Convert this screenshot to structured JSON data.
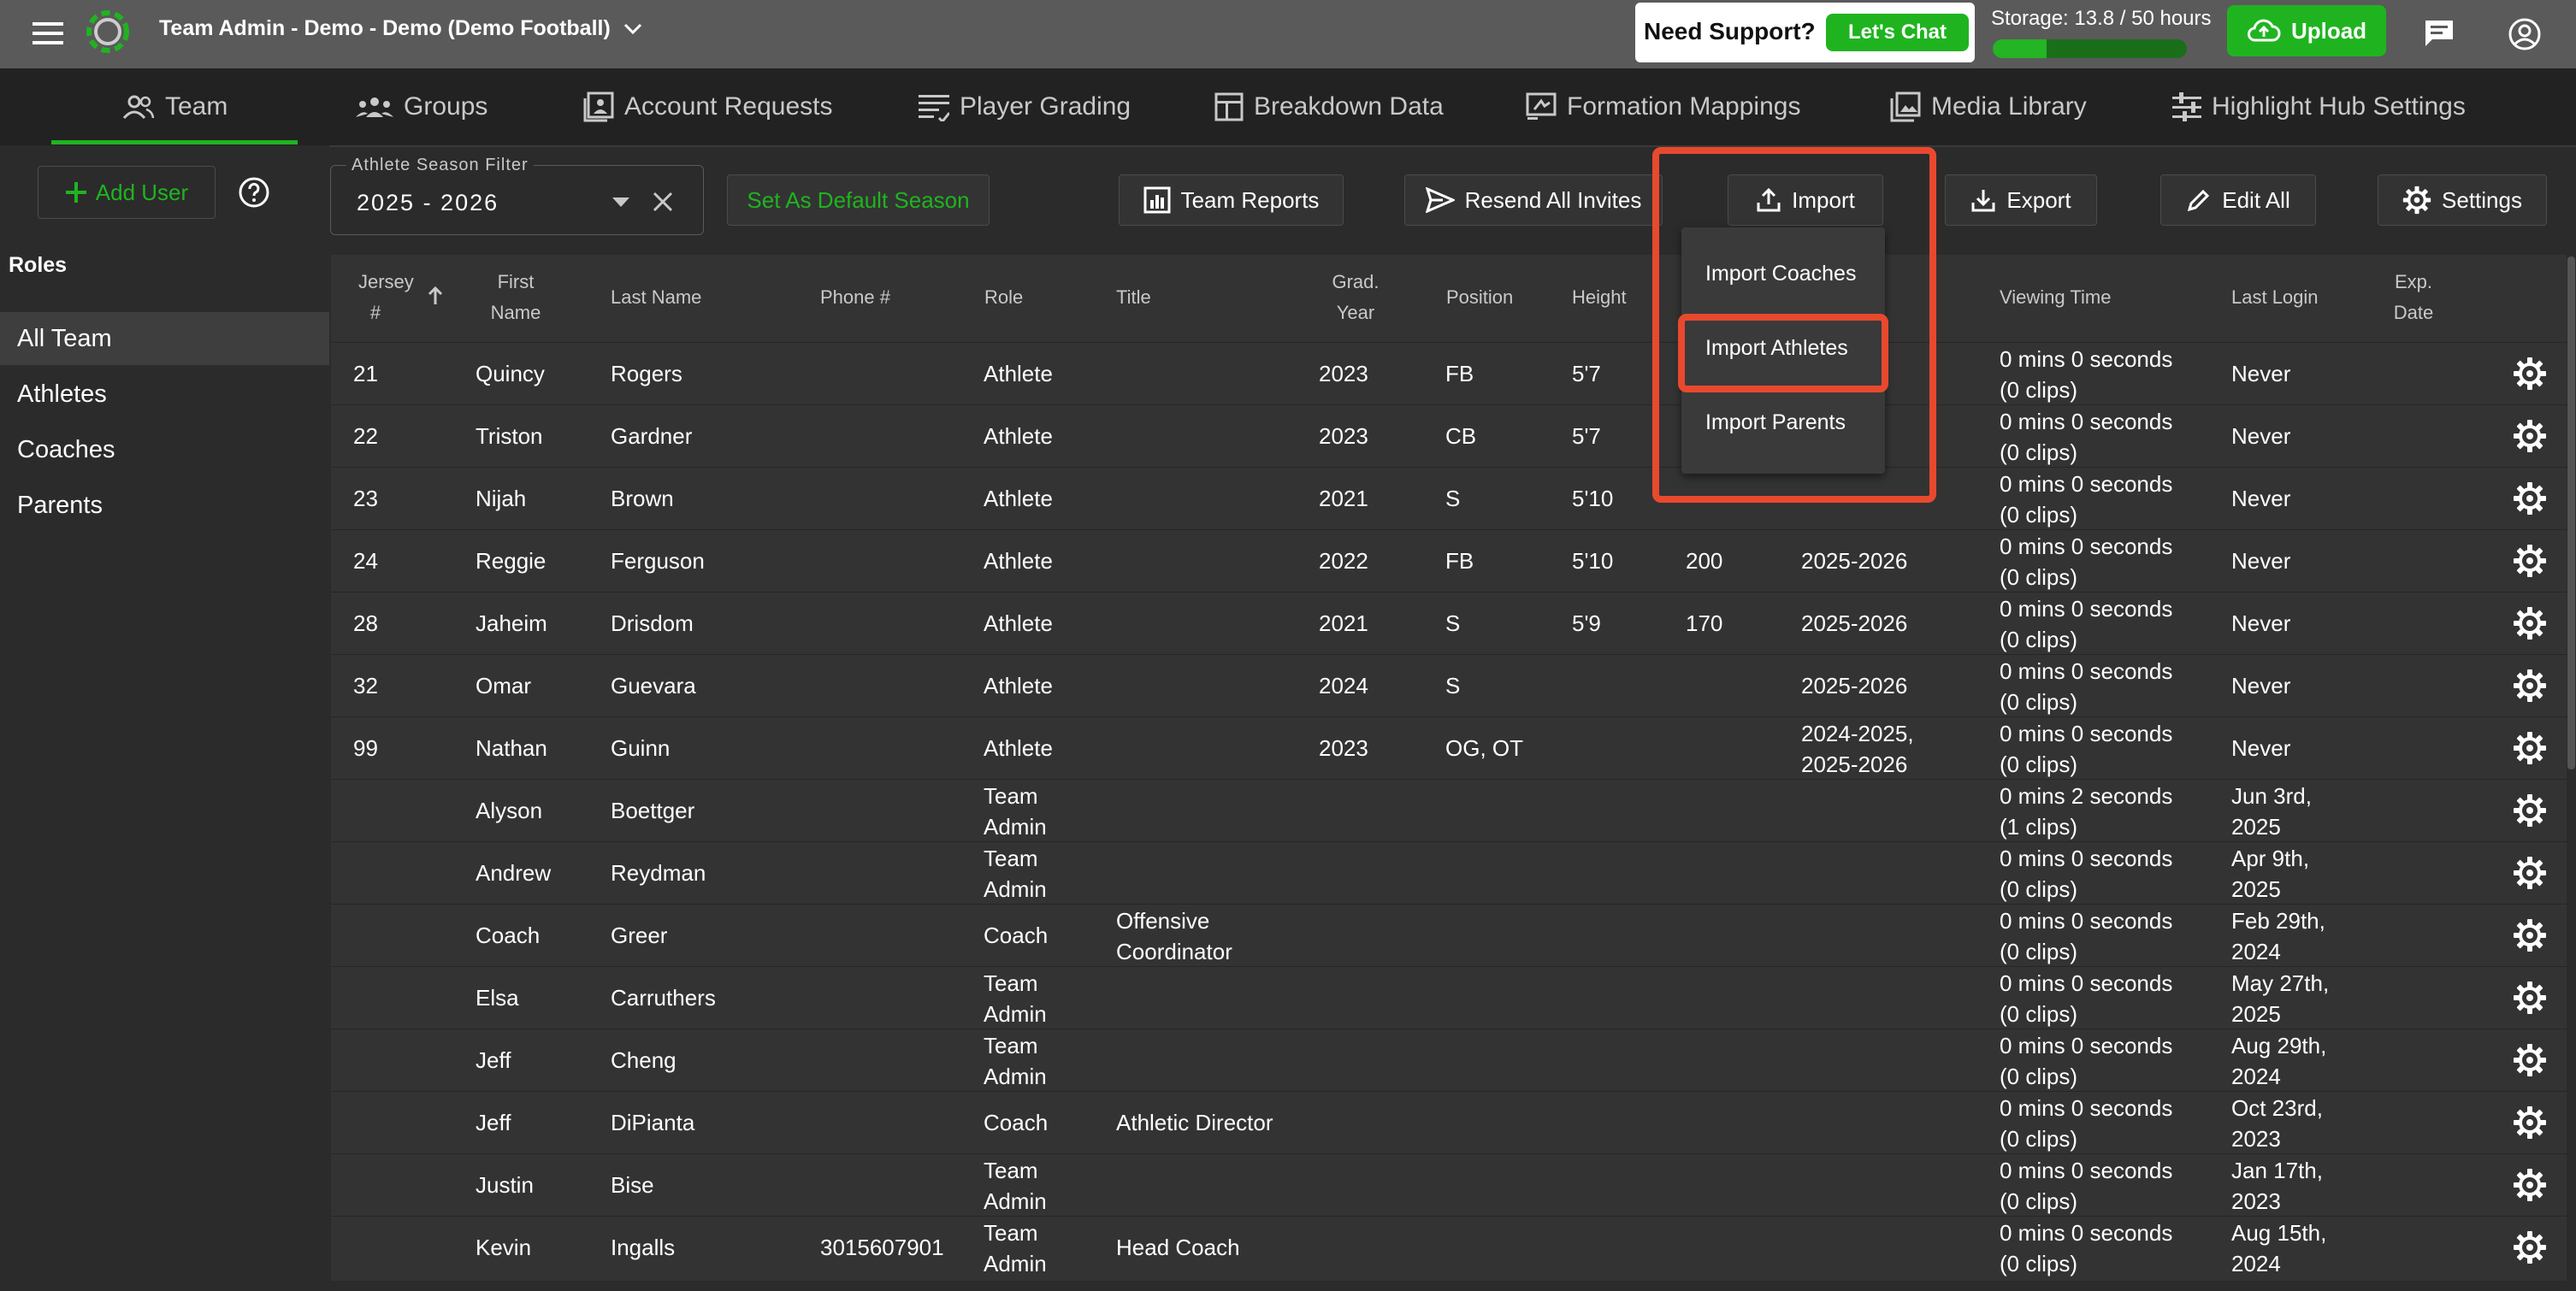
{
  "header": {
    "title": "Team Admin - Demo - Demo (Demo Football)",
    "support_label": "Need Support?",
    "chat_label": "Let's Chat",
    "storage_label": "Storage: 13.8 / 50 hours",
    "storage_fraction": 0.276,
    "upload_label": "Upload"
  },
  "tabs": [
    {
      "label": "Team",
      "icon": "team-icon"
    },
    {
      "label": "Groups",
      "icon": "groups-icon"
    },
    {
      "label": "Account Requests",
      "icon": "account-requests-icon"
    },
    {
      "label": "Player Grading",
      "icon": "player-grading-icon"
    },
    {
      "label": "Breakdown Data",
      "icon": "breakdown-data-icon"
    },
    {
      "label": "Formation Mappings",
      "icon": "formation-mappings-icon"
    },
    {
      "label": "Media Library",
      "icon": "media-library-icon"
    },
    {
      "label": "Highlight Hub Settings",
      "icon": "sliders-icon"
    }
  ],
  "toolbar": {
    "add_user": "Add User",
    "season_filter_label": "Athlete Season Filter",
    "season_filter_value": "2025 - 2026",
    "set_default": "Set As Default Season",
    "team_reports": "Team Reports",
    "resend_invites": "Resend All Invites",
    "import": "Import",
    "export": "Export",
    "edit_all": "Edit All",
    "settings": "Settings"
  },
  "import_menu": [
    "Import Coaches",
    "Import Athletes",
    "Import Parents"
  ],
  "sidebar": {
    "heading": "Roles",
    "items": [
      "All Team",
      "Athletes",
      "Coaches",
      "Parents"
    ]
  },
  "table": {
    "columns": {
      "jersey_1": "Jersey",
      "jersey_2": "#",
      "first_1": "First",
      "first_2": "Name",
      "last": "Last Name",
      "phone": "Phone #",
      "role": "Role",
      "title": "Title",
      "grad_1": "Grad.",
      "grad_2": "Year",
      "position": "Position",
      "height": "Height",
      "viewing": "Viewing Time",
      "last_login": "Last Login",
      "exp_1": "Exp.",
      "exp_2": "Date"
    },
    "rows": [
      {
        "jersey": "21",
        "first": "Quincy",
        "last": "Rogers",
        "phone": "",
        "role1": "Athlete",
        "role2": "",
        "title1": "",
        "title2": "",
        "grad": "2023",
        "position": "FB",
        "height": "5'7",
        "weight": "",
        "season1": "26",
        "season2": "",
        "view1": "0 mins 0 seconds",
        "view2": "(0 clips)",
        "login1": "Never",
        "login2": ""
      },
      {
        "jersey": "22",
        "first": "Triston",
        "last": "Gardner",
        "phone": "",
        "role1": "Athlete",
        "role2": "",
        "title1": "",
        "title2": "",
        "grad": "2023",
        "position": "CB",
        "height": "5'7",
        "weight": "",
        "season1": "26",
        "season2": "",
        "view1": "0 mins 0 seconds",
        "view2": "(0 clips)",
        "login1": "Never",
        "login2": ""
      },
      {
        "jersey": "23",
        "first": "Nijah",
        "last": "Brown",
        "phone": "",
        "role1": "Athlete",
        "role2": "",
        "title1": "",
        "title2": "",
        "grad": "2021",
        "position": "S",
        "height": "5'10",
        "weight": "",
        "season1": "",
        "season2": "",
        "view1": "0 mins 0 seconds",
        "view2": "(0 clips)",
        "login1": "Never",
        "login2": ""
      },
      {
        "jersey": "24",
        "first": "Reggie",
        "last": "Ferguson",
        "phone": "",
        "role1": "Athlete",
        "role2": "",
        "title1": "",
        "title2": "",
        "grad": "2022",
        "position": "FB",
        "height": "5'10",
        "weight": "200",
        "season1": "2025-2026",
        "season2": "",
        "view1": "0 mins 0 seconds",
        "view2": "(0 clips)",
        "login1": "Never",
        "login2": ""
      },
      {
        "jersey": "28",
        "first": "Jaheim",
        "last": "Drisdom",
        "phone": "",
        "role1": "Athlete",
        "role2": "",
        "title1": "",
        "title2": "",
        "grad": "2021",
        "position": "S",
        "height": "5'9",
        "weight": "170",
        "season1": "2025-2026",
        "season2": "",
        "view1": "0 mins 0 seconds",
        "view2": "(0 clips)",
        "login1": "Never",
        "login2": ""
      },
      {
        "jersey": "32",
        "first": "Omar",
        "last": "Guevara",
        "phone": "",
        "role1": "Athlete",
        "role2": "",
        "title1": "",
        "title2": "",
        "grad": "2024",
        "position": "S",
        "height": "",
        "weight": "",
        "season1": "2025-2026",
        "season2": "",
        "view1": "0 mins 0 seconds",
        "view2": "(0 clips)",
        "login1": "Never",
        "login2": ""
      },
      {
        "jersey": "99",
        "first": "Nathan",
        "last": "Guinn",
        "phone": "",
        "role1": "Athlete",
        "role2": "",
        "title1": "",
        "title2": "",
        "grad": "2023",
        "position": "OG, OT",
        "height": "",
        "weight": "",
        "season1": "2024-2025,",
        "season2": "2025-2026",
        "view1": "0 mins 0 seconds",
        "view2": "(0 clips)",
        "login1": "Never",
        "login2": ""
      },
      {
        "jersey": "",
        "first": "Alyson",
        "last": "Boettger",
        "phone": "",
        "role1": "Team",
        "role2": "Admin",
        "title1": "",
        "title2": "",
        "grad": "",
        "position": "",
        "height": "",
        "weight": "",
        "season1": "",
        "season2": "",
        "view1": "0 mins 2 seconds",
        "view2": "(1 clips)",
        "login1": "Jun 3rd,",
        "login2": "2025"
      },
      {
        "jersey": "",
        "first": "Andrew",
        "last": "Reydman",
        "phone": "",
        "role1": "Team",
        "role2": "Admin",
        "title1": "",
        "title2": "",
        "grad": "",
        "position": "",
        "height": "",
        "weight": "",
        "season1": "",
        "season2": "",
        "view1": "0 mins 0 seconds",
        "view2": "(0 clips)",
        "login1": "Apr 9th,",
        "login2": "2025"
      },
      {
        "jersey": "",
        "first": "Coach",
        "last": "Greer",
        "phone": "",
        "role1": "Coach",
        "role2": "",
        "title1": "Offensive",
        "title2": "Coordinator",
        "grad": "",
        "position": "",
        "height": "",
        "weight": "",
        "season1": "",
        "season2": "",
        "view1": "0 mins 0 seconds",
        "view2": "(0 clips)",
        "login1": "Feb 29th,",
        "login2": "2024"
      },
      {
        "jersey": "",
        "first": "Elsa",
        "last": "Carruthers",
        "phone": "",
        "role1": "Team",
        "role2": "Admin",
        "title1": "",
        "title2": "",
        "grad": "",
        "position": "",
        "height": "",
        "weight": "",
        "season1": "",
        "season2": "",
        "view1": "0 mins 0 seconds",
        "view2": "(0 clips)",
        "login1": "May 27th,",
        "login2": "2025"
      },
      {
        "jersey": "",
        "first": "Jeff",
        "last": "Cheng",
        "phone": "",
        "role1": "Team",
        "role2": "Admin",
        "title1": "",
        "title2": "",
        "grad": "",
        "position": "",
        "height": "",
        "weight": "",
        "season1": "",
        "season2": "",
        "view1": "0 mins 0 seconds",
        "view2": "(0 clips)",
        "login1": "Aug 29th,",
        "login2": "2024"
      },
      {
        "jersey": "",
        "first": "Jeff",
        "last": "DiPianta",
        "phone": "",
        "role1": "Coach",
        "role2": "",
        "title1": "Athletic Director",
        "title2": "",
        "grad": "",
        "position": "",
        "height": "",
        "weight": "",
        "season1": "",
        "season2": "",
        "view1": "0 mins 0 seconds",
        "view2": "(0 clips)",
        "login1": "Oct 23rd,",
        "login2": "2023"
      },
      {
        "jersey": "",
        "first": "Justin",
        "last": "Bise",
        "phone": "",
        "role1": "Team",
        "role2": "Admin",
        "title1": "",
        "title2": "",
        "grad": "",
        "position": "",
        "height": "",
        "weight": "",
        "season1": "",
        "season2": "",
        "view1": "0 mins 0 seconds",
        "view2": "(0 clips)",
        "login1": "Jan 17th,",
        "login2": "2023"
      },
      {
        "jersey": "",
        "first": "Kevin",
        "last": "Ingalls",
        "phone": "3015607901",
        "role1": "Team",
        "role2": "Admin",
        "title1": "Head Coach",
        "title2": "",
        "grad": "",
        "position": "",
        "height": "",
        "weight": "",
        "season1": "",
        "season2": "",
        "view1": "0 mins 0 seconds",
        "view2": "(0 clips)",
        "login1": "Aug 15th,",
        "login2": "2024"
      }
    ]
  }
}
